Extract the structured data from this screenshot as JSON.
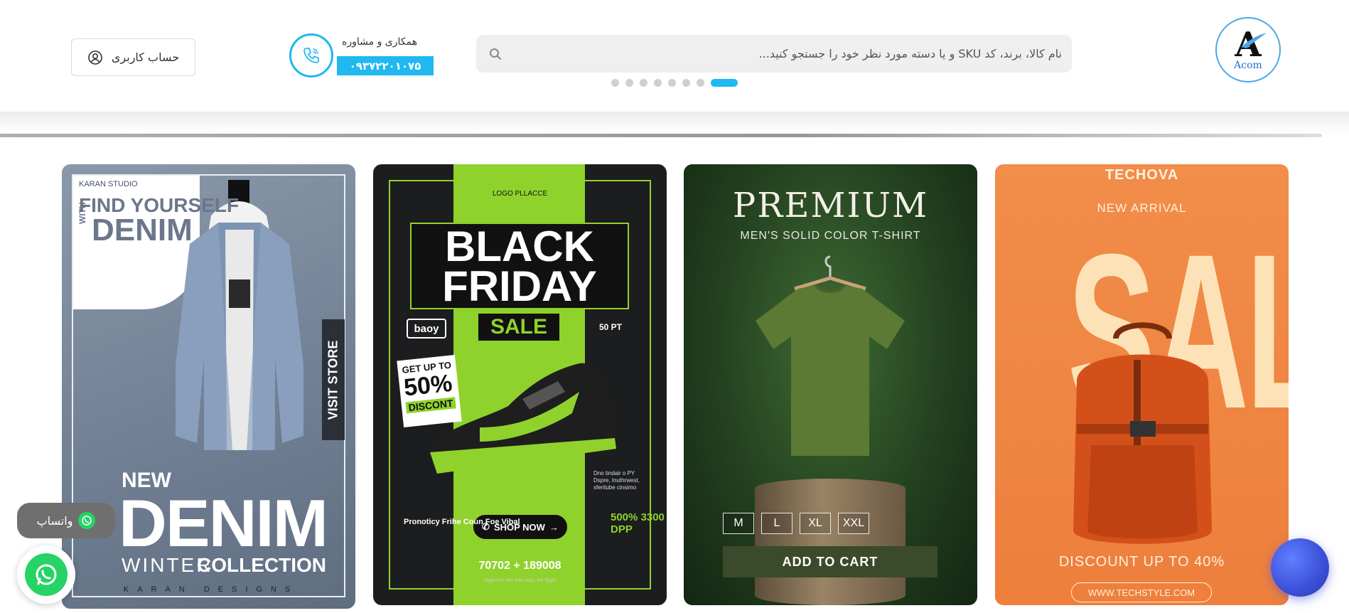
{
  "header": {
    "logo": {
      "letter": "A",
      "text": "Acom"
    },
    "search": {
      "placeholder": "نام کالا، برند، کد SKU و یا دسته مورد نظر خود را جستجو کنید...",
      "icon": "search-icon"
    },
    "carousel": {
      "count": 8,
      "active_index": 7
    },
    "contact": {
      "label": "همکاری و مشاوره",
      "phone": "۰۹۳۷۲۲۰۱۰۷۵",
      "icon": "phone-icon"
    },
    "account": {
      "label": "حساب کاربری",
      "icon": "user-icon"
    }
  },
  "banners": [
    {
      "studio": "KARAN STUDIO",
      "find": "FIND YOURSELF",
      "with": "WITH",
      "denim_small": "DENIM",
      "visit": "VISIT STORE",
      "new": "NEW",
      "denim": "DENIM",
      "winter": "WINTER",
      "collection": "COLLECTION",
      "designs": "KARAN DESIGNS"
    },
    {
      "logo": "LOGO PLLACCE",
      "title": "BLACK FRIDAY",
      "sale": "SALE",
      "tag": "baoy",
      "pt": "50 PT",
      "disc_a": "GET UP TO",
      "disc_b": "50%",
      "disc_c": "DISCONT",
      "shop": "SHOP NOW",
      "left_text": "Pronoticy Frihe Coun Foe Vibal",
      "right_text": "500% 3300 DPP",
      "right_small": "Dno tindair o PY Dspre, Inuthrwest, sferitube cinsimo",
      "phone": "70702 + 189008",
      "small": "Yaghneel Vee hoo sags foe Iltgec"
    },
    {
      "title": "PREMIUM",
      "subtitle": "MEN'S SOLID COLOR T-SHIRT",
      "sizes": [
        "M",
        "L",
        "XL",
        "XXL"
      ],
      "cart": "ADD TO CART"
    },
    {
      "brand": "TECHOVA",
      "new": "NEW ARRIVAL",
      "sale": "SALE",
      "discount": "DISCOUNT UP TO 40%",
      "url": "WWW.TECHSTYLE.COM"
    }
  ],
  "floating": {
    "whatsapp_label": "واتساپ",
    "whatsapp_icon": "whatsapp-icon",
    "chat_icon": "chat-bubble-icon"
  },
  "colors": {
    "accent": "#1fb8f0",
    "neon": "#8fd22c",
    "whatsapp": "#25d366"
  }
}
